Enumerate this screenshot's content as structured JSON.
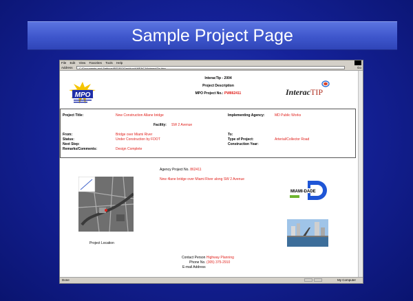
{
  "slide": {
    "title": "Sample Project Page"
  },
  "browser": {
    "menu": [
      "File",
      "Edit",
      "View",
      "Favorites",
      "Tools",
      "Help"
    ],
    "address_label": "Address",
    "address_value": "C:\\Documents and Settings\\PEDRO\\Desktop\\AMENCA\\InteractTip.htm",
    "go_label": "Go",
    "status_left": "Done",
    "status_right": "My Computer"
  },
  "header": {
    "logo_text": "MPO",
    "line1": "InteracTip - 2004",
    "line2": "Project Description",
    "line3_label": "MPO Project No.:",
    "line3_value": "PW862411",
    "brand_main": "Interac",
    "brand_tip": "TIP"
  },
  "info": {
    "project_title_label": "Project Title:",
    "project_title_value": "New Construction Allane bridge",
    "agency_label": "Implementing Agency:",
    "agency_value": "MD Public Works",
    "facility_label": "Facility:",
    "facility_value": "SW 2 Avenue",
    "from_label": "From:",
    "from_value": "Bridge over Miami River",
    "to_label": "To:",
    "status_label": "Status:",
    "status_value": "Under Construction by FDOT",
    "type_label": "Type of Project:",
    "type_value": "Arterial/Collector Road",
    "next_label": "Next Step:",
    "year_label": "Construction Year:",
    "remarks_label": "Remarks/Comments:",
    "remarks_value": "Design Complete"
  },
  "details": {
    "agency_project_label": "Agency Project No.",
    "agency_project_value": "862411",
    "description": "New 4lane bridge over Miami River along SW 2 Avenue",
    "map_caption": "Project Location",
    "miami_logo_text": "MIAMI-DADE",
    "contact_label": "Contact Person",
    "contact_value": "Highway Planning",
    "phone_label": "Phone No.",
    "phone_value": "(305) 375-2910",
    "email_label": "E-mail Address"
  }
}
